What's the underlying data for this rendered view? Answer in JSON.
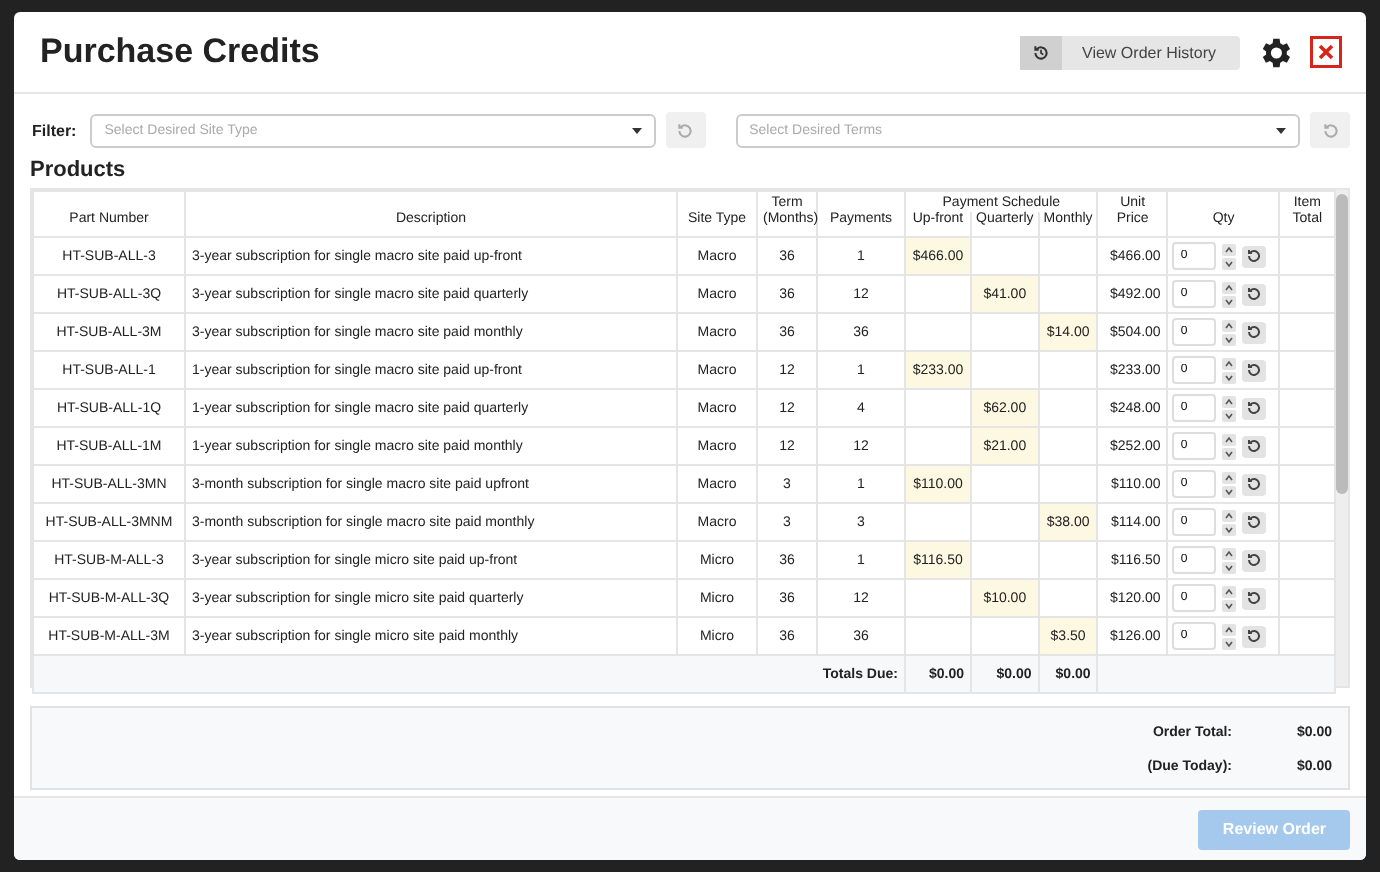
{
  "modal": {
    "title": "Purchase Credits",
    "history_button": "View Order History"
  },
  "filter": {
    "label": "Filter:",
    "site_type": {
      "placeholder": "Select Desired Site Type"
    },
    "terms": {
      "placeholder": "Select Desired Terms"
    }
  },
  "products": {
    "title": "Products",
    "columns": {
      "part": "Part Number",
      "description": "Description",
      "site_type": "Site Type",
      "term": "Term (Months)",
      "payments": "Payments",
      "schedule": "Payment Schedule",
      "upfront": "Up-front",
      "quarterly": "Quarterly",
      "monthly": "Monthly",
      "unit_price": "Unit Price",
      "qty": "Qty",
      "item_total": "Item Total"
    },
    "rows": [
      {
        "part": "HT-SUB-ALL-3",
        "description": "3-year subscription for single macro site paid up-front",
        "site_type": "Macro",
        "term": "36",
        "payments": "1",
        "upfront": "$466.00",
        "unit_price": "$466.00",
        "qty": "0"
      },
      {
        "part": "HT-SUB-ALL-3Q",
        "description": "3-year subscription for single macro site paid quarterly",
        "site_type": "Macro",
        "term": "36",
        "payments": "12",
        "quarterly": "$41.00",
        "unit_price": "$492.00",
        "qty": "0"
      },
      {
        "part": "HT-SUB-ALL-3M",
        "description": "3-year subscription for single macro site paid monthly",
        "site_type": "Macro",
        "term": "36",
        "payments": "36",
        "monthly": "$14.00",
        "unit_price": "$504.00",
        "qty": "0"
      },
      {
        "part": "HT-SUB-ALL-1",
        "description": "1-year subscription for single macro site paid up-front",
        "site_type": "Macro",
        "term": "12",
        "payments": "1",
        "upfront": "$233.00",
        "unit_price": "$233.00",
        "qty": "0"
      },
      {
        "part": "HT-SUB-ALL-1Q",
        "description": "1-year subscription for single macro site paid quarterly",
        "site_type": "Macro",
        "term": "12",
        "payments": "4",
        "quarterly": "$62.00",
        "unit_price": "$248.00",
        "qty": "0"
      },
      {
        "part": "HT-SUB-ALL-1M",
        "description": "1-year subscription for single macro site paid monthly",
        "site_type": "Macro",
        "term": "12",
        "payments": "12",
        "quarterly": "$21.00",
        "unit_price": "$252.00",
        "qty": "0"
      },
      {
        "part": "HT-SUB-ALL-3MN",
        "description": "3-month subscription for single macro site paid upfront",
        "site_type": "Macro",
        "term": "3",
        "payments": "1",
        "upfront": "$110.00",
        "unit_price": "$110.00",
        "qty": "0"
      },
      {
        "part": "HT-SUB-ALL-3MNM",
        "description": "3-month subscription for single macro site paid monthly",
        "site_type": "Macro",
        "term": "3",
        "payments": "3",
        "monthly": "$38.00",
        "unit_price": "$114.00",
        "qty": "0"
      },
      {
        "part": "HT-SUB-M-ALL-3",
        "description": "3-year subscription for single micro site paid up-front",
        "site_type": "Micro",
        "term": "36",
        "payments": "1",
        "upfront": "$116.50",
        "unit_price": "$116.50",
        "qty": "0"
      },
      {
        "part": "HT-SUB-M-ALL-3Q",
        "description": "3-year subscription for single micro site paid quarterly",
        "site_type": "Micro",
        "term": "36",
        "payments": "12",
        "quarterly": "$10.00",
        "unit_price": "$120.00",
        "qty": "0"
      },
      {
        "part": "HT-SUB-M-ALL-3M",
        "description": "3-year subscription for single micro site paid monthly",
        "site_type": "Micro",
        "term": "36",
        "payments": "36",
        "monthly": "$3.50",
        "unit_price": "$126.00",
        "qty": "0"
      }
    ],
    "totals": {
      "label": "Totals Due:",
      "upfront": "$0.00",
      "quarterly": "$0.00",
      "monthly": "$0.00"
    }
  },
  "summary": {
    "order_total_label": "Order Total:",
    "order_total": "$0.00",
    "due_today_label": "(Due Today):",
    "due_today": "$0.00"
  },
  "footer": {
    "review_button": "Review Order",
    "review_disabled": true
  }
}
